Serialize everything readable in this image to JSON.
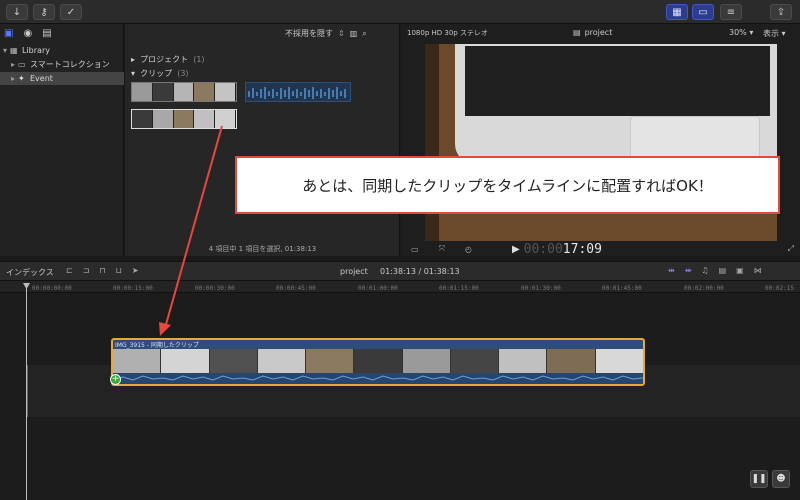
{
  "sidebar": {
    "items": [
      {
        "label": "Library"
      },
      {
        "label": "スマートコレクション"
      },
      {
        "label": "Event"
      }
    ]
  },
  "browser": {
    "filter_label": "不採用を隠す",
    "section_project": "プロジェクト",
    "section_project_count": "(1)",
    "section_clip": "クリップ",
    "section_clip_count": "(3)",
    "status_text": "4 項目中 1 項目を選択, 01:38:13"
  },
  "viewer": {
    "format_label": "1080p HD 30p ステレオ",
    "project_name": "project",
    "zoom_label": "30%",
    "display_label": "表示",
    "timecode_dim": "00:00",
    "timecode": "17:09"
  },
  "timeline": {
    "index_label": "インデックス",
    "project_name": "project",
    "duration": "01:38:13 / 01:38:13",
    "ruler_ticks": [
      "00:00:00:00",
      "00:00:15:00",
      "00:00:30:00",
      "00:00:45:00",
      "00:01:00:00",
      "00:01:15:00",
      "00:01:30:00",
      "00:01:45:00",
      "00:02:00:00",
      "00:02:15"
    ],
    "clip_label": "IMG_3915 - 同期したクリップ"
  },
  "callout": {
    "text": "あとは、同期したクリップをタイムラインに配置すればOK！"
  },
  "colors": {
    "accent": "#2c3d8f",
    "callout_border": "#e8473d",
    "clip_border": "#e8a834",
    "clip_fill": "#2d4d7a"
  }
}
